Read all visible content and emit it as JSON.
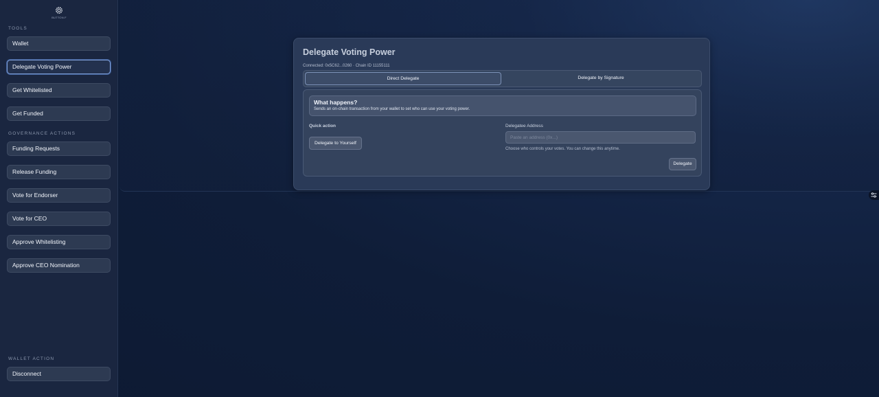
{
  "sidebar": {
    "logo_text": "BUTTON.F",
    "tools_label": "TOOLS",
    "tools": [
      {
        "label": "Wallet"
      },
      {
        "label": "Delegate Voting Power",
        "active": true
      },
      {
        "label": "Get Whitelisted"
      },
      {
        "label": "Get Funded"
      }
    ],
    "governance_label": "GOVERNANCE ACTIONS",
    "governance": [
      {
        "label": "Funding Requests"
      },
      {
        "label": "Release Funding"
      },
      {
        "label": "Vote for Endorser"
      },
      {
        "label": "Vote for CEO"
      },
      {
        "label": "Approve Whitelisting"
      },
      {
        "label": "Approve CEO Nomination"
      }
    ],
    "wallet_label": "WALLET ACTION",
    "disconnect_label": "Disconnect"
  },
  "card": {
    "title": "Delegate Voting Power",
    "meta": "Connected: 0x5C62...0260 · Chain ID 11155111",
    "tabs": [
      {
        "label": "Direct Delegate",
        "active": true
      },
      {
        "label": "Delegate by Signature"
      }
    ],
    "info": {
      "title": "What happens?",
      "text": "Sends an on-chain transaction from your wallet to set who can use your voting power."
    },
    "quick_action": {
      "label": "Quick action",
      "button": "Delegate to Yourself"
    },
    "delegatee": {
      "label": "Delegatee Address",
      "placeholder": "Paste an address (0x...)",
      "value": "",
      "help": "Choose who controls your votes. You can change this anytime."
    },
    "submit_label": "Delegate"
  },
  "colors": {
    "accent_border": "#7f9fd8",
    "sidebar_bg": "#1a2640",
    "card_bg": "#2a3a58"
  },
  "icons": {
    "logo": "gear-logo-icon",
    "floating": "settings-sliders-icon"
  }
}
